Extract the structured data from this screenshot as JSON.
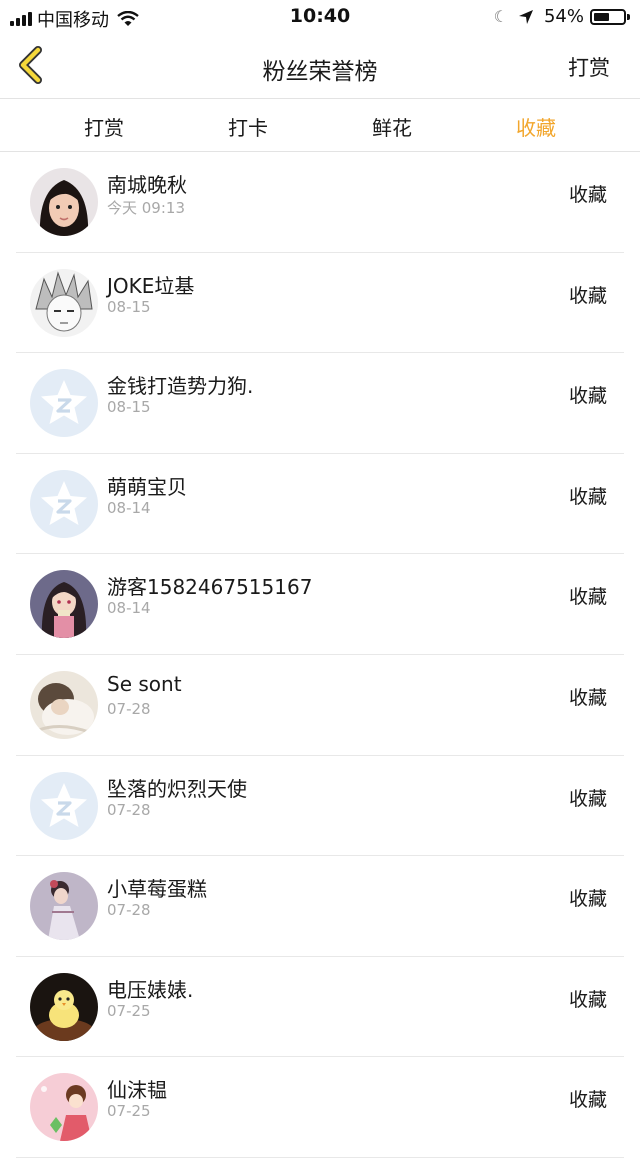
{
  "status_bar": {
    "carrier": "中国移动",
    "time": "10:40",
    "battery": "54%",
    "battery_level": 0.54
  },
  "nav": {
    "title": "粉丝荣誉榜",
    "right_label": "打赏"
  },
  "tabs": [
    {
      "label": "打赏",
      "active": false
    },
    {
      "label": "打卡",
      "active": false
    },
    {
      "label": "鲜花",
      "active": false
    },
    {
      "label": "收藏",
      "active": true
    }
  ],
  "fans": [
    {
      "name": "南城晚秋",
      "date": "今天 09:13",
      "action": "收藏",
      "avatar": "photo-girl"
    },
    {
      "name": "JOKE垃基",
      "date": "08-15",
      "action": "收藏",
      "avatar": "anime-sketch"
    },
    {
      "name": "金钱打造势力狗.",
      "date": "08-15",
      "action": "收藏",
      "avatar": "default-star"
    },
    {
      "name": "萌萌宝贝",
      "date": "08-14",
      "action": "收藏",
      "avatar": "default-star"
    },
    {
      "name": "游客1582467515167",
      "date": "08-14",
      "action": "收藏",
      "avatar": "anime-girl"
    },
    {
      "name": "Se sont",
      "date": "07-28",
      "action": "收藏",
      "avatar": "photo-hug"
    },
    {
      "name": "坠落的炽烈天使",
      "date": "07-28",
      "action": "收藏",
      "avatar": "default-star"
    },
    {
      "name": "小草莓蛋糕",
      "date": "07-28",
      "action": "收藏",
      "avatar": "photo-dress"
    },
    {
      "name": "电压婊婊.",
      "date": "07-25",
      "action": "收藏",
      "avatar": "chick"
    },
    {
      "name": "仙沫韫",
      "date": "07-25",
      "action": "收藏",
      "avatar": "cartoon-pink"
    }
  ]
}
